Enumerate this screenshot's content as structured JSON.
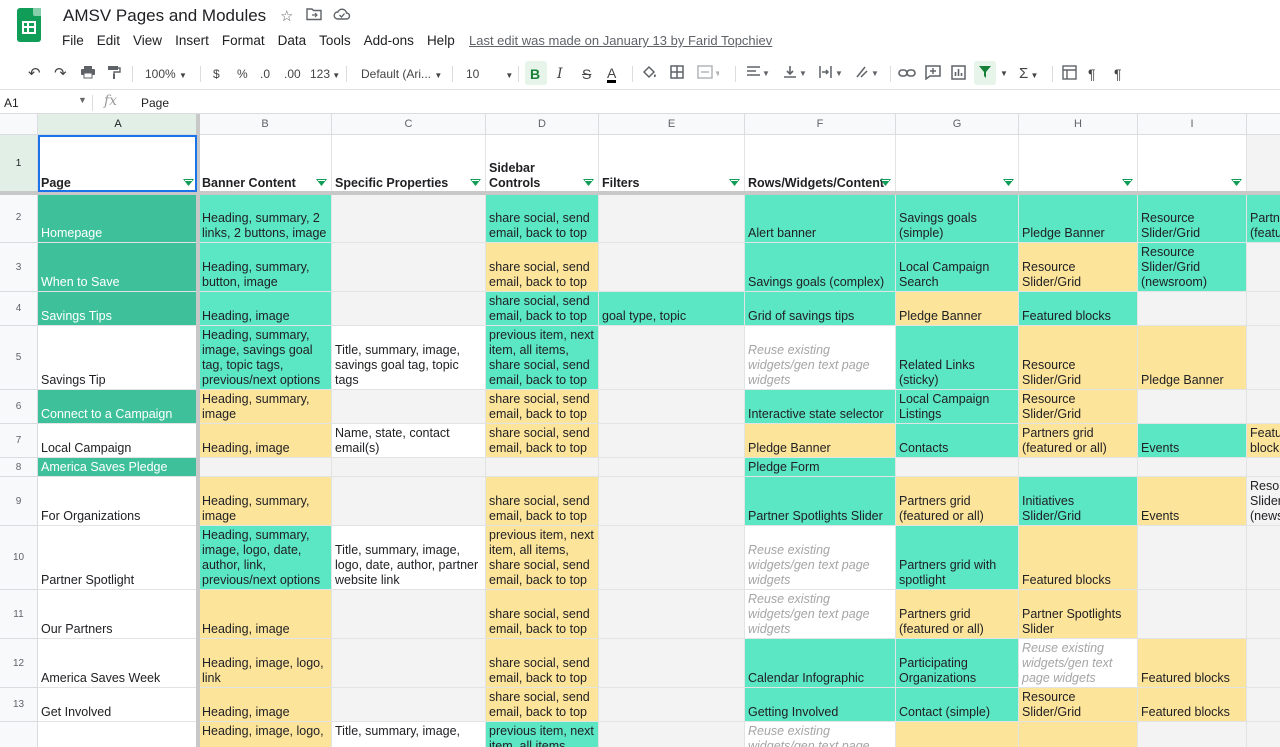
{
  "app": {
    "title": "AMSV Pages and Modules",
    "menu": [
      "File",
      "Edit",
      "View",
      "Insert",
      "Format",
      "Data",
      "Tools",
      "Add-ons",
      "Help"
    ],
    "last_edit": "Last edit was made on January 13 by Farid Topchiev"
  },
  "toolbar": {
    "zoom": "100%",
    "currency": "$",
    "percent": "%",
    "dec_decrease": ".0",
    "dec_increase": ".00",
    "more_formats": "123",
    "font": "Default (Ari...",
    "font_size": "10",
    "bold": "B",
    "italic": "I",
    "strike": "S",
    "text_color": "A",
    "sum": "Σ"
  },
  "formula_bar": {
    "cell_ref": "A1",
    "fx": "fx",
    "content": "Page"
  },
  "grid": {
    "columns": [
      "A",
      "B",
      "C",
      "D",
      "E",
      "F",
      "G",
      "H",
      "I"
    ],
    "rows": [
      {
        "num": "1",
        "h": 58,
        "cells": [
          "Page",
          "Banner Content",
          "Specific Properties",
          "Sidebar\nControls",
          "Filters",
          "Rows/Widgets/Content",
          "",
          "",
          ""
        ],
        "cls": [
          "hdr w",
          "hdr w",
          "hdr w",
          "hdr w",
          "hdr w",
          "hdr w",
          "hdr w",
          "hdr w",
          "hdr w"
        ]
      },
      {
        "num": "2",
        "h": 50,
        "cells": [
          "Homepage",
          "Heading, summary, 2 links, 2 buttons, image",
          "",
          "share social, send email, back to top",
          "",
          "Alert banner",
          "Savings goals (simple)",
          "Pledge Banner",
          "Resource Slider/Grid",
          "Partn (featu"
        ],
        "cls": [
          "dk",
          "t1",
          "g",
          "t1",
          "g",
          "t1",
          "t1",
          "t1",
          "t1",
          "t1"
        ]
      },
      {
        "num": "3",
        "h": 49,
        "cells": [
          "When to Save",
          "Heading, summary, button, image",
          "",
          "share social, send email, back to top",
          "",
          "Savings goals (complex)",
          "Local Campaign Search",
          "Resource Slider/Grid",
          "Resource Slider/Grid (newsroom)",
          ""
        ],
        "cls": [
          "dk",
          "t1",
          "g",
          "y",
          "g",
          "t1",
          "t1",
          "y",
          "t1",
          "g"
        ]
      },
      {
        "num": "4",
        "h": 34,
        "cells": [
          "Savings Tips",
          "Heading, image",
          "",
          "share social, send email, back to top",
          "goal type, topic",
          "Grid of savings tips",
          "Pledge Banner",
          "Featured blocks",
          "",
          ""
        ],
        "cls": [
          "dk",
          "t1",
          "g",
          "t1",
          "t1",
          "t1",
          "y",
          "t1",
          "g",
          "g"
        ]
      },
      {
        "num": "5",
        "h": 64,
        "cells": [
          "Savings Tip",
          "Heading, summary, image, savings goal tag, topic tags, previous/next options",
          "Title, summary, image, savings goal tag, topic tags",
          "previous item, next item, all items, share social, send email, back to top",
          "",
          "Reuse existing widgets/gen text page widgets",
          "Related Links (sticky)",
          "Resource Slider/Grid",
          "Pledge Banner",
          ""
        ],
        "cls": [
          "w",
          "t1",
          "w",
          "t1",
          "g",
          "w it",
          "t1",
          "y",
          "y",
          "g"
        ]
      },
      {
        "num": "6",
        "h": 34,
        "cells": [
          "Connect to a Campaign",
          "Heading, summary, image",
          "",
          "share social, send email, back to top",
          "",
          "Interactive state selector",
          "Local Campaign Listings",
          "Resource Slider/Grid",
          "",
          ""
        ],
        "cls": [
          "dk",
          "y",
          "g",
          "y",
          "g",
          "t1",
          "t1",
          "y",
          "g",
          "g"
        ]
      },
      {
        "num": "7",
        "h": 34,
        "cells": [
          "Local Campaign",
          "Heading, image",
          "Name, state, contact email(s)",
          "share social, send email, back to top",
          "",
          "Pledge Banner",
          "Contacts",
          "Partners grid (featured or all)",
          "Events",
          "Featu block"
        ],
        "cls": [
          "w",
          "y",
          "w",
          "y",
          "g",
          "y",
          "t1",
          "y",
          "t1",
          "y"
        ]
      },
      {
        "num": "8",
        "h": 19,
        "cells": [
          "America Saves Pledge",
          "",
          "",
          "",
          "",
          "Pledge Form",
          "",
          "",
          "",
          ""
        ],
        "cls": [
          "dk",
          "g",
          "g",
          "g",
          "g",
          "t1",
          "g",
          "g",
          "g",
          "g"
        ]
      },
      {
        "num": "9",
        "h": 49,
        "cells": [
          "For Organizations",
          "Heading, summary, image",
          "",
          "share social, send email, back to top",
          "",
          "Partner Spotlights Slider",
          "Partners grid (featured or all)",
          "Initiatives Slider/Grid",
          "Events",
          "Reso Slider (news"
        ],
        "cls": [
          "w",
          "y",
          "g",
          "y",
          "g",
          "t1",
          "y",
          "t1",
          "y",
          "g"
        ]
      },
      {
        "num": "10",
        "h": 64,
        "cells": [
          "Partner Spotlight",
          "Heading, summary, image, logo, date, author, link, previous/next options",
          "Title, summary, image, logo, date, author, partner website link",
          "previous item, next item, all items, share social, send email, back to top",
          "",
          "Reuse existing widgets/gen text page widgets",
          "Partners grid with spotlight",
          "Featured blocks",
          "",
          ""
        ],
        "cls": [
          "w",
          "t1",
          "w",
          "y",
          "g",
          "w it",
          "t1",
          "y",
          "g",
          "g"
        ]
      },
      {
        "num": "11",
        "h": 49,
        "cells": [
          "Our Partners",
          "Heading, image",
          "",
          "share social, send email, back to top",
          "",
          "Reuse existing widgets/gen text page widgets",
          "Partners grid (featured or all)",
          "Partner Spotlights Slider",
          "",
          ""
        ],
        "cls": [
          "w",
          "y",
          "g",
          "y",
          "g",
          "w it",
          "y",
          "y",
          "g",
          "g"
        ]
      },
      {
        "num": "12",
        "h": 49,
        "cells": [
          "America Saves Week",
          "Heading, image, logo, link",
          "",
          "share social, send email, back to top",
          "",
          "Calendar Infographic",
          "Participating Organizations",
          "Reuse existing widgets/gen text page widgets",
          "Featured blocks",
          ""
        ],
        "cls": [
          "w",
          "y",
          "g",
          "y",
          "g",
          "t1",
          "t1",
          "w it",
          "y",
          "g"
        ]
      },
      {
        "num": "13",
        "h": 34,
        "cells": [
          "Get Involved",
          "Heading, image",
          "",
          "share social, send email, back to top",
          "",
          "Getting Involved",
          "Contact (simple)",
          "Resource Slider/Grid",
          "Featured blocks",
          ""
        ],
        "cls": [
          "w",
          "y",
          "g",
          "y",
          "g",
          "t1",
          "t1",
          "y",
          "y",
          "g"
        ]
      },
      {
        "num": "14",
        "h": 60,
        "cells": [
          "",
          "Heading, image, logo,",
          "Title, summary, image,",
          "previous item, next item, all items, share social, send",
          "",
          "Reuse existing widgets/gen text page",
          "",
          "",
          "",
          ""
        ],
        "cls": [
          "w",
          "y",
          "w",
          "t1",
          "g",
          "w it",
          "y",
          "y",
          "g",
          "g"
        ],
        "top": true
      }
    ]
  }
}
